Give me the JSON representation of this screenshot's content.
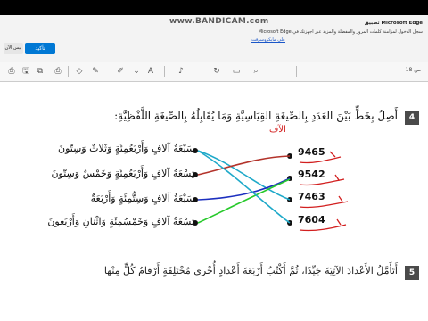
{
  "notification": {
    "title": "تطبيق Microsoft Edge",
    "text": "سجل الدخول لمزامنة كلمات المرور والمفضلة والمزيد عبر أجهزتك في Microsoft Edge",
    "link": "علي مايكروسوفت",
    "confirm": "تأكيد",
    "decline": "ليس الآن"
  },
  "watermark": "www.BANDICAM.com",
  "toolbar": {
    "page_label": "من 18"
  },
  "question": {
    "number": "4",
    "text": "أَصِلُ بِخَطٍّ بَيْنَ العَدَدِ بِالصِّيغَةِ القِيَاسِيَّةِ وَمَا يُقَابِلُهُ بِالصِّيغَةِ اللَّفْظِيَّةِ:"
  },
  "word_forms": [
    "سَبْعَةُ آلافٍ وَأَرْبَعُمِئَةٍ وَثَلاثٌ وَسِتّونَ",
    "تِسْعَةُ آلافٍ وَأَرْبَعُمِئَةٍ وَخَمْسٌ وَسِتّونَ",
    "سَبْعَةُ آلافٍ وَسِتُّمِئَةٍ وَأَرْبَعَةٌ",
    "تِسْعَةُ آلافٍ وَخَمْسُمِئَةٍ وَاثْنانِ وَأَرْبَعونَ"
  ],
  "standard_forms": [
    "9465",
    "9542",
    "7463",
    "7604"
  ],
  "handwriting": [
    "الآف"
  ],
  "next_question": {
    "number": "5",
    "text": "أَتَأَمَّلُ الأَعْدادَ الآتِيَةَ جَيِّدًا، ثُمَّ أَكْتُبُ أَرْبَعَةَ أَعْدادٍ أُخْرى مُخْتَلِفَةٍ أَرْقامُ كُلٍّ مِنْها"
  }
}
